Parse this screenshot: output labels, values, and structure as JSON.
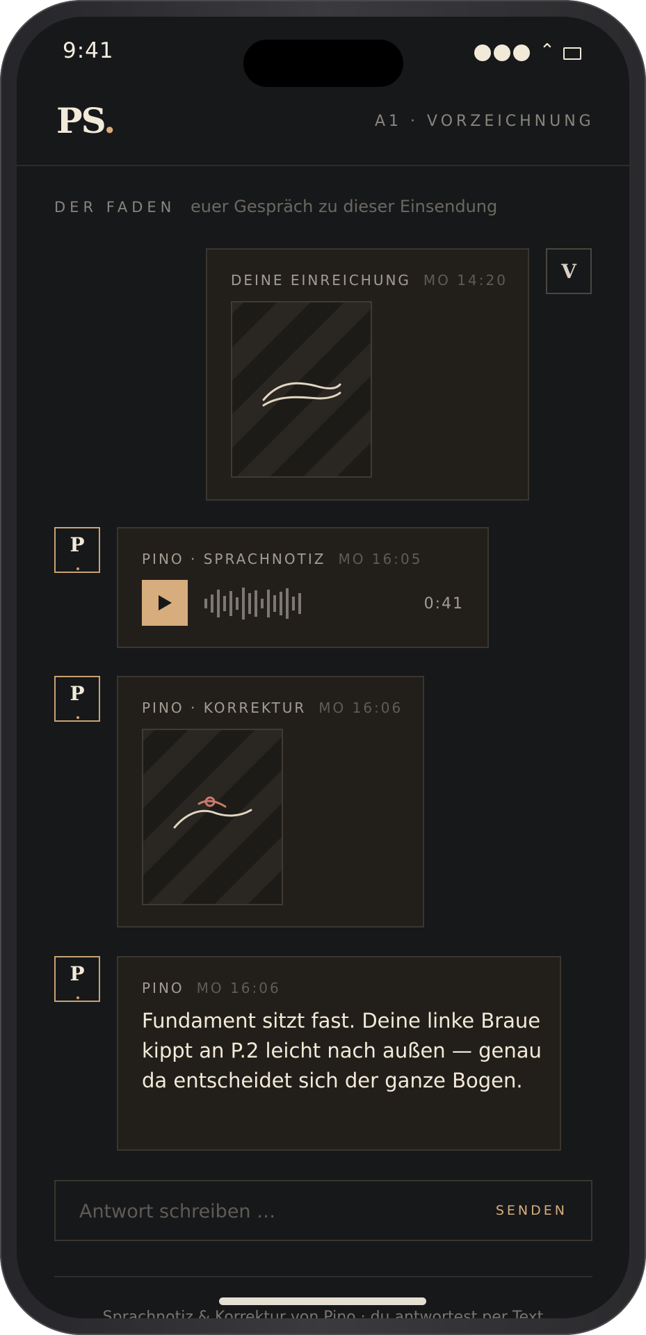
{
  "status": {
    "time": "9:41"
  },
  "header": {
    "logo_text": "PS",
    "logo_dot": ".",
    "context": "A1 · VORZEICHNUNG"
  },
  "thread": {
    "kicker": "DER FADEN",
    "subtitle": "euer Gespräch zu dieser Einsendung"
  },
  "user": {
    "avatar_initial": "V"
  },
  "messages": [
    {
      "author": "DEINE EINREICHUNG",
      "time": "MO 14:20"
    },
    {
      "avatar": "P",
      "author": "PINO · SPRACHNOTIZ",
      "time": "MO 16:05",
      "duration": "0:41"
    },
    {
      "avatar": "P",
      "author": "PINO · KORREKTUR",
      "time": "MO 16:06"
    },
    {
      "avatar": "P",
      "author": "PINO",
      "time": "MO 16:06",
      "text": "Fundament sitzt fast. Deine linke Braue kippt an P.2 leicht nach außen — genau da entscheidet sich der ganze Bogen."
    }
  ],
  "reply": {
    "placeholder": "Antwort schreiben …",
    "send_label": "SENDEN"
  },
  "footer": {
    "text": "Sprachnotiz & Korrektur von Pino · du antwortest per Text"
  },
  "icons": {
    "play": "play-icon",
    "signal": "signal-icon",
    "wifi": "wifi-icon",
    "battery": "battery-icon"
  },
  "colors": {
    "accent": "#d7ad7d",
    "background": "#17181a",
    "card": "#221f1b",
    "correction": "#c97a6b"
  }
}
